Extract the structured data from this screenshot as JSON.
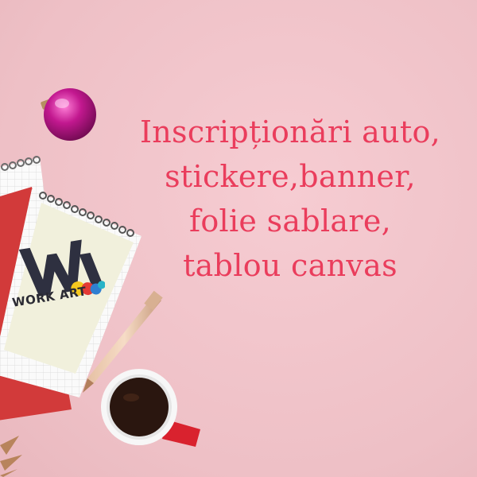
{
  "headline": {
    "line1": "Inscripționări auto,",
    "line2": "stickere,banner,",
    "line3": "folie sablare,",
    "line4": "tablou canvas"
  },
  "logo": {
    "text": "WORK ART"
  },
  "colors": {
    "background": "#f2c4ca",
    "headline": "#ea3d5c",
    "ornament": "#c2188f",
    "notebook_cover": "#d23a3a",
    "coffee_cup": "#d9222e"
  }
}
